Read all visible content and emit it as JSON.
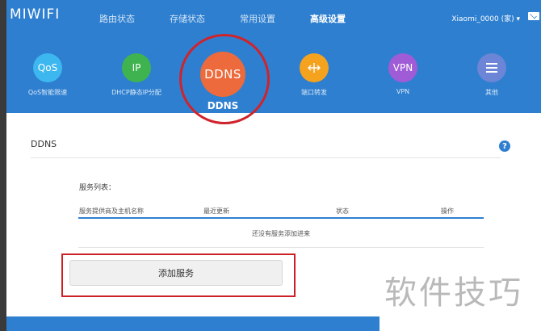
{
  "header": {
    "logo": "MIWIFI",
    "nav": [
      "路由状态",
      "存储状态",
      "常用设置",
      "高级设置"
    ],
    "active_nav": "高级设置",
    "account": "Xiaomi_0000 (家) ▾"
  },
  "functions": [
    {
      "icon_text": "QoS",
      "label": "QoS智能限速",
      "color": "#3db7ef"
    },
    {
      "icon_text": "IP",
      "label": "DHCP静态IP分配",
      "color": "#3fb34f"
    },
    {
      "icon_text": "DDNS",
      "label": "DDNS",
      "color": "#ec6a3b"
    },
    {
      "icon_text": "",
      "label": "端口转发",
      "color": "#f5a21e"
    },
    {
      "icon_text": "VPN",
      "label": "VPN",
      "color": "#a05cd6"
    },
    {
      "icon_text": "",
      "label": "其他",
      "color": "#6c85d6"
    }
  ],
  "content": {
    "section_title": "DDNS",
    "help": "?",
    "list_title": "服务列表：",
    "columns": [
      "服务提供商及主机名称",
      "最近更新",
      "状态",
      "操作"
    ],
    "empty_text": "还没有服务添加进来",
    "add_button": "添加服务"
  },
  "watermark": "软件技巧"
}
